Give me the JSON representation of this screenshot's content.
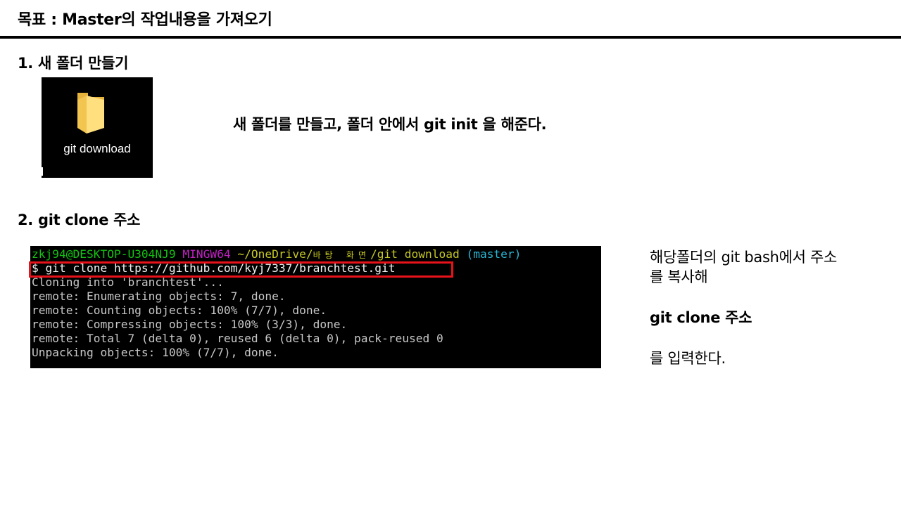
{
  "title": "목표 : Master의 작업내용을 가져오기",
  "step1": {
    "heading": "1. 새 폴더 만들기",
    "folder_label": "git download",
    "folder_icon": "folder-icon",
    "description": "새 폴더를 만들고, 폴더 안에서 git init 을 해준다."
  },
  "step2": {
    "heading": "2. git clone 주소",
    "terminal": {
      "prompt_user": "zkj94@DESKTOP-U304NJ9",
      "prompt_env": "MINGW64",
      "prompt_path_a": "~/OneDrive/",
      "prompt_path_kr": "바탕 화면",
      "prompt_path_b": "/git download",
      "prompt_branch": "(master)",
      "command": "$ git clone https://github.com/kyj7337/branchtest.git",
      "output": [
        "Cloning into 'branchtest'...",
        "remote: Enumerating objects: 7, done.",
        "remote: Counting objects: 100% (7/7), done.",
        "remote: Compressing objects: 100% (3/3), done.",
        "remote: Total 7 (delta 0), reused 6 (delta 0), pack-reused 0",
        "Unpacking objects: 100% (7/7), done."
      ]
    },
    "note": {
      "line1": "해당폴더의 git bash에서 주소",
      "line2": "를 복사해",
      "command": "git clone 주소",
      "line3": "를 입력한다."
    }
  },
  "colors": {
    "highlight": "#e8131a",
    "terminal_bg": "#000000",
    "prompt_green": "#12c412",
    "prompt_magenta": "#c21fc2",
    "prompt_yellow": "#c8c826",
    "prompt_cyan": "#29b8d8"
  }
}
